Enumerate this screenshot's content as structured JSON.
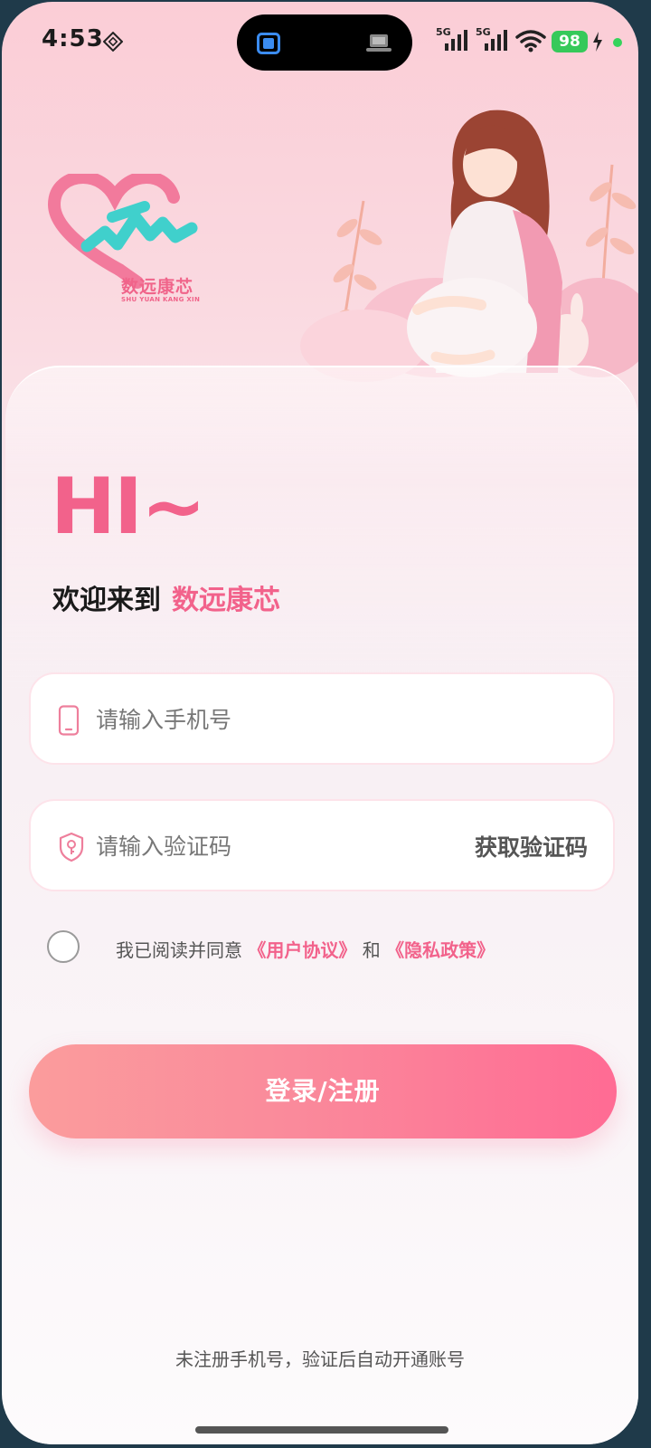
{
  "status_bar": {
    "time": "4:53",
    "signal_1": "5G",
    "signal_2": "5G",
    "battery": "98"
  },
  "logo": {
    "name": "数远康芯",
    "subtitle": "SHU YUAN KANG XIN"
  },
  "greeting": "HI~",
  "welcome": {
    "prefix": "欢迎来到",
    "brand": "数远康芯"
  },
  "form": {
    "phone_placeholder": "请输入手机号",
    "code_placeholder": "请输入验证码",
    "get_code_label": "获取验证码"
  },
  "agreement": {
    "text_prefix": "我已阅读并同意",
    "user_agreement": "《用户协议》",
    "and": "和",
    "privacy_policy": "《隐私政策》",
    "checked": false
  },
  "login_button_label": "登录/注册",
  "footer_note": "未注册手机号，验证后自动开通账号",
  "colors": {
    "accent": "#f2628b",
    "teal": "#40d0cc",
    "button_start": "#fb9c9c",
    "button_end": "#ff6b94"
  }
}
